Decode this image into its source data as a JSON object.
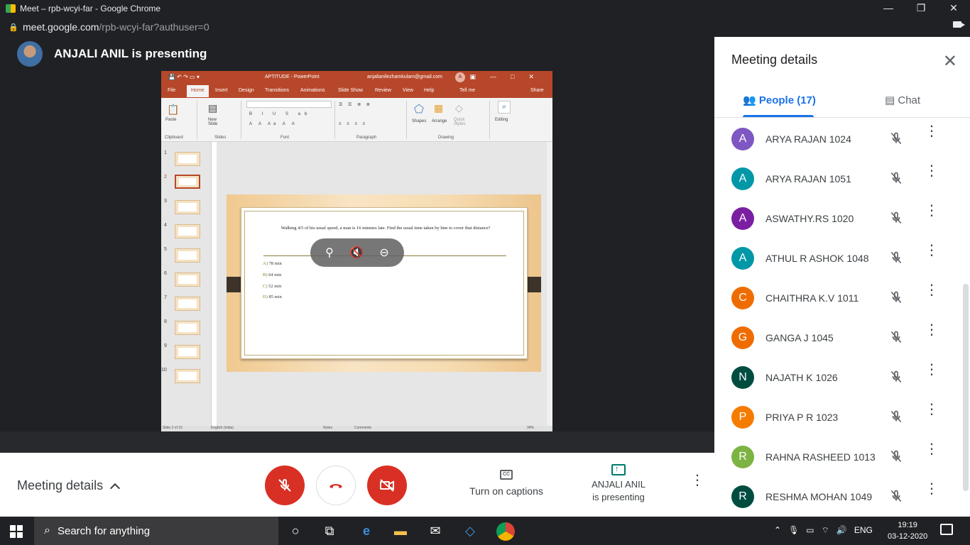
{
  "window": {
    "title": "Meet – rpb-wcyi-far - Google Chrome",
    "minimize": "—",
    "restore": "❐",
    "close": "✕"
  },
  "address": {
    "host": "meet.google.com",
    "path": "/rpb-wcyi-far?authuser=0"
  },
  "presenter": {
    "text": "ANJALI ANIL is presenting"
  },
  "ppt": {
    "doc_title": "APTITUDE  -  PowerPoint",
    "account": "anjalianilezhamkulam@gmail.com",
    "account_initial": "A",
    "tabs": [
      "File",
      "Home",
      "Insert",
      "Design",
      "Transitions",
      "Animations",
      "Slide Show",
      "Review",
      "View",
      "Help",
      "Tell me",
      "Share"
    ],
    "ribbon_groups": [
      "Clipboard",
      "Slides",
      "Font",
      "Paragraph",
      "Drawing"
    ],
    "ribbon_labels": {
      "paste": "Paste",
      "new_slide": "New\nSlide",
      "shapes": "Shapes",
      "arrange": "Arrange",
      "quick_styles": "Quick\nStyles",
      "editing": "Editing"
    },
    "thumb_numbers": [
      "1",
      "2",
      "3",
      "4",
      "5",
      "6",
      "7",
      "8",
      "9",
      "10"
    ],
    "selected_slide": 2,
    "question": "Walking 4/5 of his usual speed, a man is 16 minutes late. Find the usual time taken by him to cover that distance?",
    "options": [
      {
        "key": "A)",
        "text": "78 min"
      },
      {
        "key": "B)",
        "text": "64 min"
      },
      {
        "key": "C)",
        "text": "52 min"
      },
      {
        "key": "D)",
        "text": "85 min"
      }
    ],
    "status_left": "Slide 2 of 10",
    "status_lang": "English (India)",
    "status_notes": "Notes",
    "status_comments": "Comments",
    "status_zoom": "34%"
  },
  "controls": {
    "meeting_details": "Meeting details",
    "captions": "Turn on captions",
    "captions_icon": "CC",
    "presenting_line1": "ANJALI ANIL",
    "presenting_line2": "is presenting"
  },
  "panel": {
    "title": "Meeting details",
    "tab_people": "People (17)",
    "tab_chat": "Chat",
    "participants": [
      {
        "initial": "A",
        "name": "ARYA RAJAN 1024",
        "color": "#7e57c2"
      },
      {
        "initial": "A",
        "name": "ARYA RAJAN 1051",
        "color": "#0097a7"
      },
      {
        "initial": "A",
        "name": "ASWATHY.RS 1020",
        "color": "#7b1fa2"
      },
      {
        "initial": "A",
        "name": "ATHUL R ASHOK 1048",
        "color": "#0097a7"
      },
      {
        "initial": "C",
        "name": "CHAITHRA K.V 1011",
        "color": "#ef6c00"
      },
      {
        "initial": "G",
        "name": "GANGA J 1045",
        "color": "#ef6c00"
      },
      {
        "initial": "N",
        "name": "NAJATH K 1026",
        "color": "#004d40"
      },
      {
        "initial": "P",
        "name": "PRIYA P R 1023",
        "color": "#f57c00"
      },
      {
        "initial": "R",
        "name": "RAHNA RASHEED 1013",
        "color": "#7cb342"
      },
      {
        "initial": "R",
        "name": "RESHMA MOHAN 1049",
        "color": "#004d40"
      }
    ]
  },
  "taskbar": {
    "search_placeholder": "Search for anything",
    "lang": "ENG",
    "time": "19:19",
    "date": "03-12-2020"
  }
}
